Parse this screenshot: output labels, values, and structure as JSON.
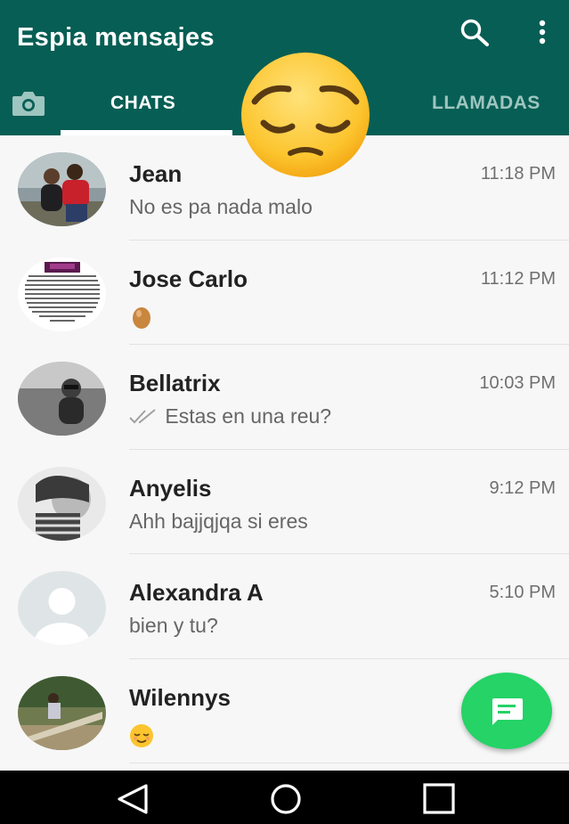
{
  "app": {
    "title": "Espia mensajes",
    "accent_color": "#075e54",
    "fab_color": "#25d366"
  },
  "header": {
    "icons": [
      "search-icon",
      "more-vert-icon",
      "camera-icon"
    ]
  },
  "tabs": [
    {
      "label": "CHATS",
      "selected": true
    },
    {
      "label": "",
      "selected": false
    },
    {
      "label": "LLAMADAS",
      "selected": false
    }
  ],
  "chats": [
    {
      "name": "Jean",
      "time": "11:18 PM",
      "preview": "No es pa nada malo",
      "ticks": false
    },
    {
      "name": "Jose Carlo",
      "time": "11:12 PM",
      "preview": "",
      "preview_icon": "egg-emoji",
      "ticks": false
    },
    {
      "name": "Bellatrix",
      "time": "10:03 PM",
      "preview": "Estas en una reu?",
      "ticks": true
    },
    {
      "name": "Anyelis",
      "time": "9:12 PM",
      "preview": "Ahh bajjqjqa si eres",
      "ticks": false
    },
    {
      "name": "Alexandra A",
      "time": "5:10 PM",
      "preview": "bien y tu?",
      "ticks": false
    },
    {
      "name": "Wilennys",
      "time": "",
      "preview": "",
      "preview_icon": "relieved-face-emoji",
      "ticks": false
    }
  ],
  "overlay": {
    "icon": "pensive-face-emoji"
  },
  "fab": {
    "icon": "new-chat-icon"
  },
  "navbar": {
    "icons": [
      "back-icon",
      "home-icon",
      "recents-icon"
    ]
  }
}
